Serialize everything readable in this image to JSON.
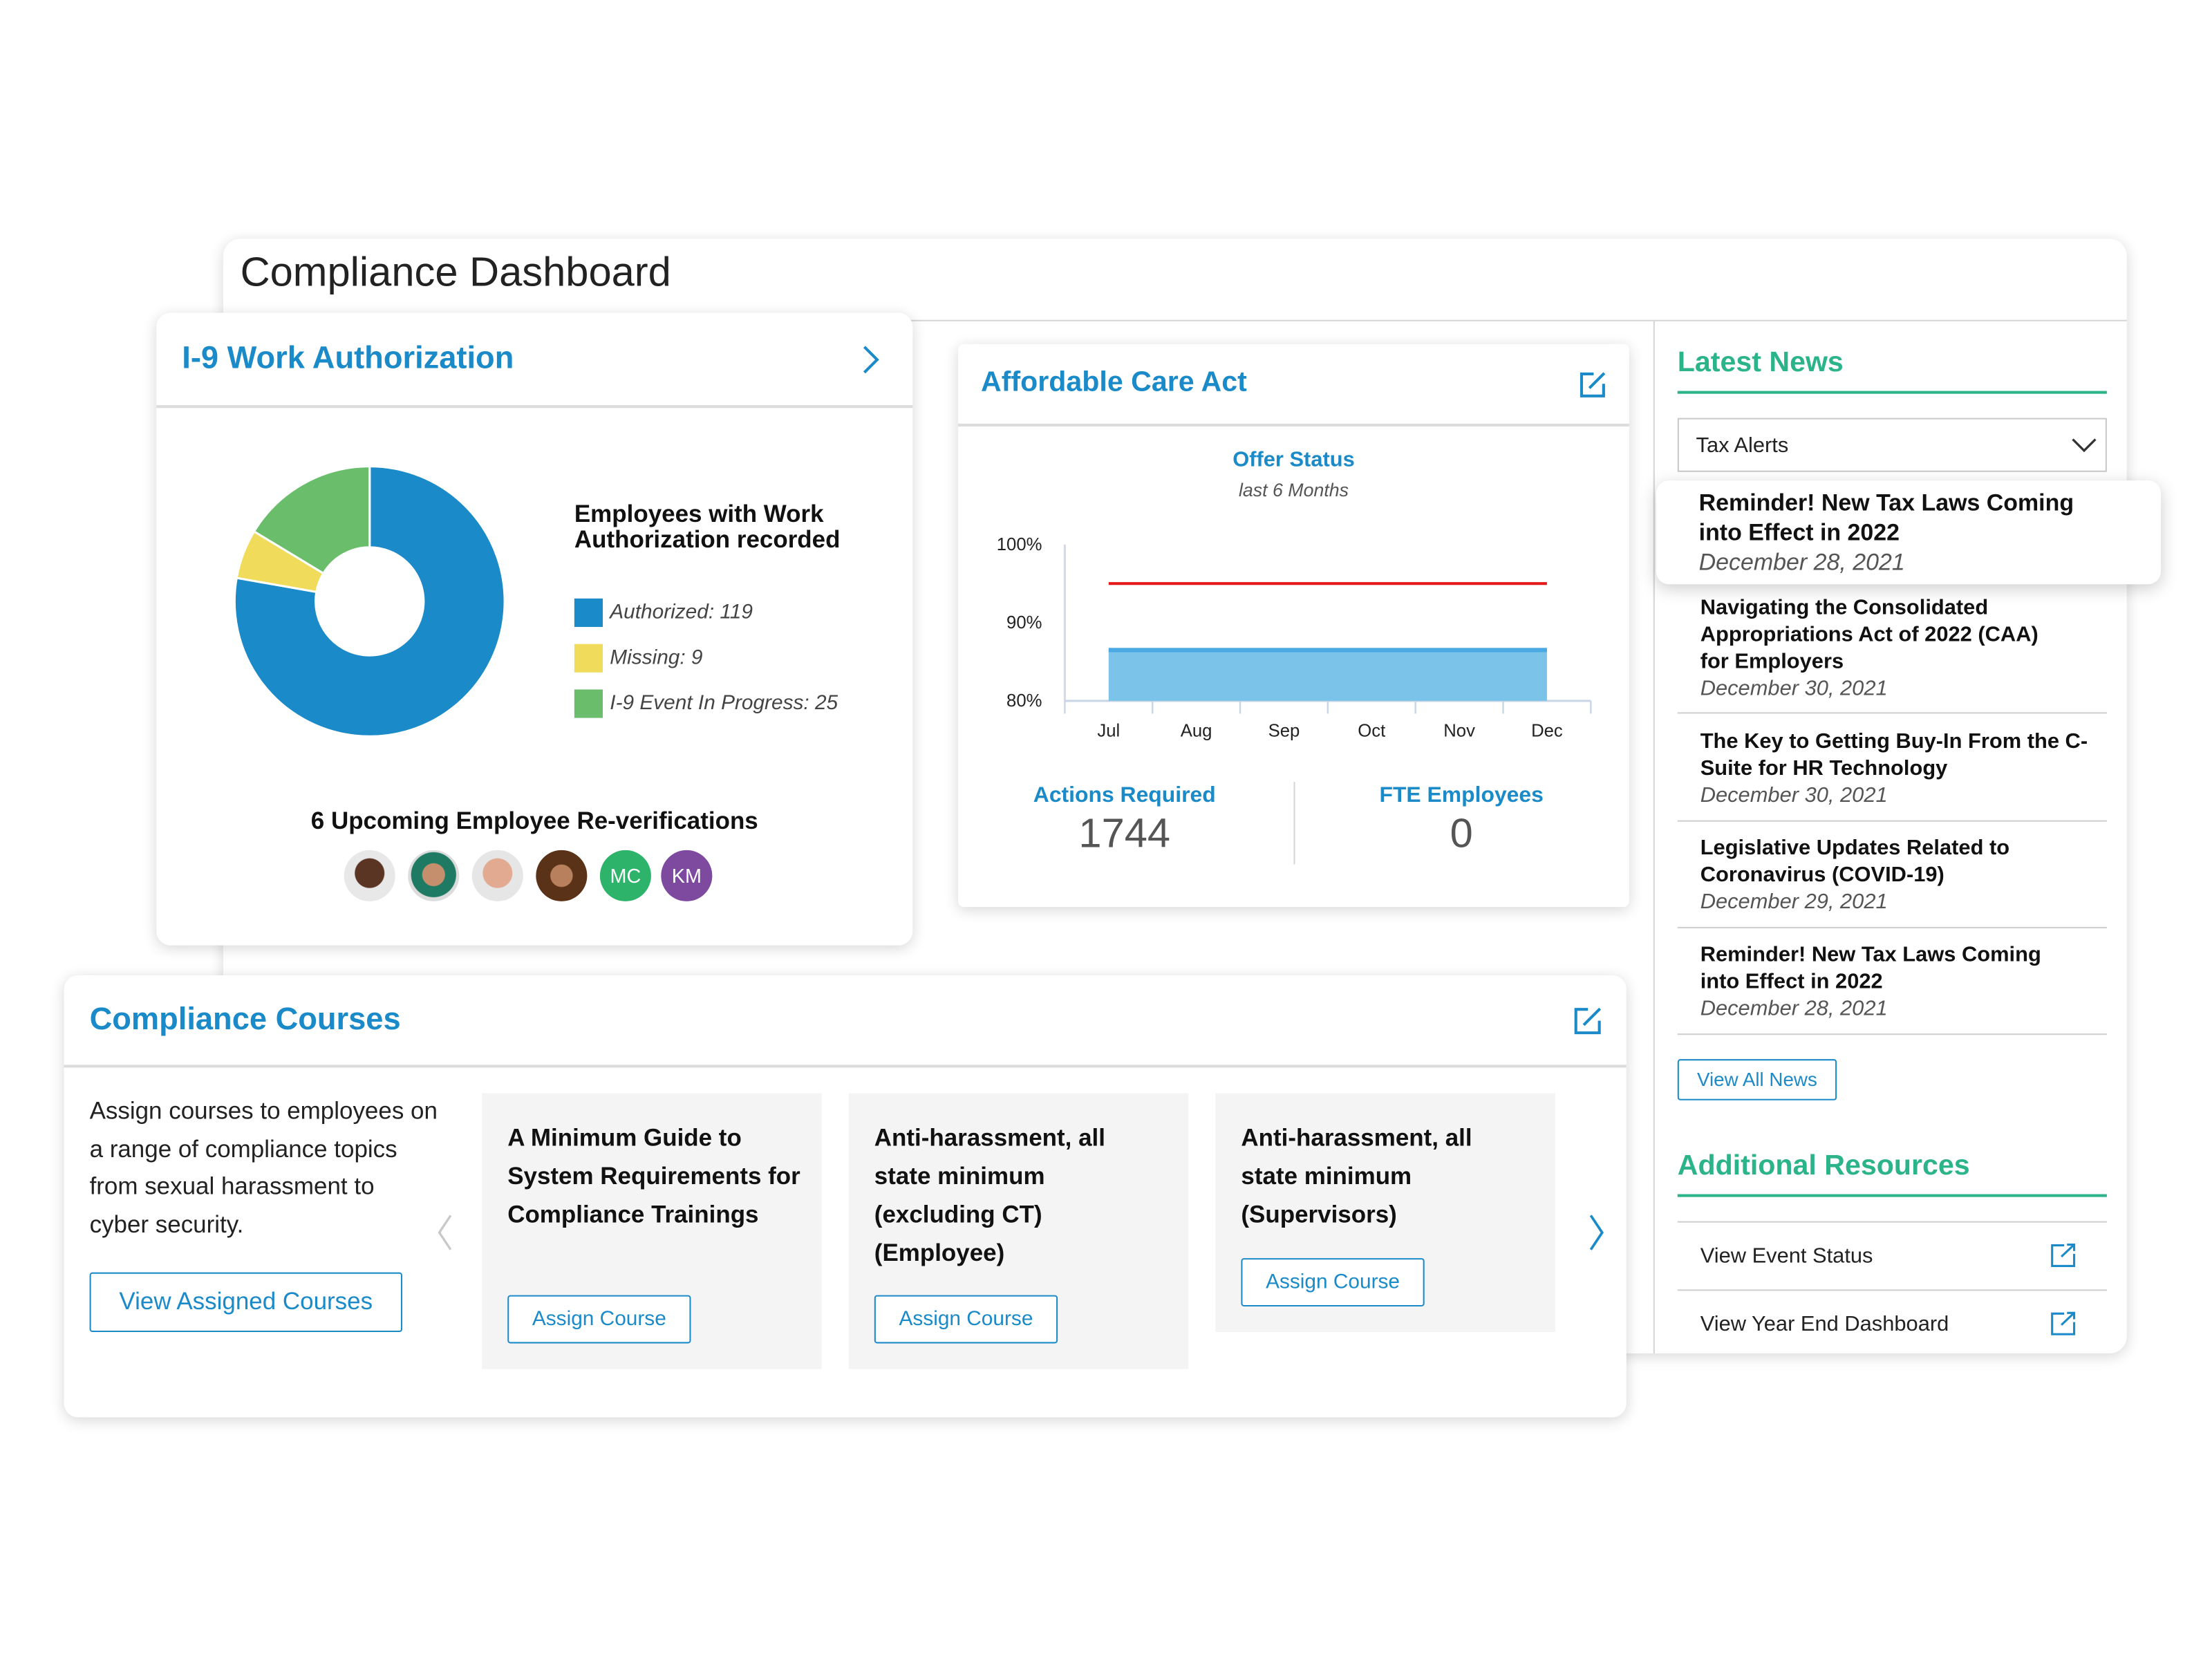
{
  "window": {
    "title": "Compliance Dashboard"
  },
  "colors": {
    "accent_blue": "#1b8ac9",
    "accent_green": "#2bb38a",
    "authorized": "#1b8ac9",
    "missing": "#f0dc5a",
    "in_progress": "#6abd6a",
    "threshold_line": "#e41a1a",
    "area_fill": "#7cc3ea"
  },
  "i9": {
    "title": "I-9 Work Authorization",
    "icon": "chevron-right-icon",
    "legend_title": "Employees with Work Authorization recorded",
    "legend": [
      {
        "label": "Authorized: 119"
      },
      {
        "label": "Missing: 9"
      },
      {
        "label": "I-9 Event In Progress: 25"
      }
    ],
    "reverifications_label": "6 Upcoming Employee Re-verifications",
    "avatars": [
      {
        "type": "photo"
      },
      {
        "type": "photo"
      },
      {
        "type": "photo"
      },
      {
        "type": "photo"
      },
      {
        "type": "initials",
        "text": "MC",
        "color": "#2db36a"
      },
      {
        "type": "initials",
        "text": "KM",
        "color": "#7d4aa0"
      }
    ]
  },
  "aca": {
    "title": "Affordable Care Act",
    "icon": "external-edit-icon",
    "chart_title": "Offer Status",
    "chart_subtitle": "last 6 Months",
    "stats": [
      {
        "label": "Actions Required",
        "value": "1744"
      },
      {
        "label": "FTE Employees",
        "value": "0"
      }
    ]
  },
  "chart_data": [
    {
      "type": "pie",
      "style": "donut",
      "categories": [
        "Authorized",
        "Missing",
        "I-9 Event In Progress"
      ],
      "values": [
        119,
        9,
        25
      ],
      "colors": [
        "#1b8ac9",
        "#f0dc5a",
        "#6abd6a"
      ],
      "legend": "right"
    },
    {
      "type": "area",
      "title": "Offer Status",
      "subtitle": "last 6 Months",
      "categories": [
        "Jul",
        "Aug",
        "Sep",
        "Oct",
        "Nov",
        "Dec"
      ],
      "y_ticks": [
        "100%",
        "90%",
        "80%"
      ],
      "ylim": [
        80,
        100
      ],
      "series": [
        {
          "values": [
            86.5,
            86.5,
            86.5,
            86.5,
            86.5,
            86.5
          ],
          "color": "#7cc3ea",
          "kind": "area"
        },
        {
          "values": [
            95,
            95,
            95,
            95,
            95,
            95
          ],
          "color": "#e41a1a",
          "kind": "line"
        }
      ],
      "grid": false
    }
  ],
  "news": {
    "title": "Latest News",
    "filter": {
      "selected": "Tax Alerts"
    },
    "items": [
      {
        "title": "Reminder! New Tax Laws Coming into Effect in 2022",
        "date": "December 28, 2021"
      },
      {
        "title": "Navigating the Consolidated Appropriations Act of 2022 (CAA) for Employers",
        "date": "December 30, 2021"
      },
      {
        "title": "The Key to Getting Buy-In From the C-Suite for HR Technology",
        "date": "December 30, 2021"
      },
      {
        "title": "Legislative Updates Related to Coronavirus (COVID-19)",
        "date": "December 29, 2021"
      },
      {
        "title": "Reminder! New Tax Laws Coming into Effect in 2022",
        "date": "December 28, 2021"
      }
    ],
    "view_all": "View All News"
  },
  "resources": {
    "title": "Additional Resources",
    "items": [
      {
        "label": "View Event Status"
      },
      {
        "label": "View Year End Dashboard"
      }
    ]
  },
  "courses": {
    "title": "Compliance Courses",
    "description": "Assign courses to employees on a range of compliance topics from sexual harassment to cyber security.",
    "view_assigned": "View Assigned Courses",
    "cards": [
      {
        "title": "A Minimum Guide to System Requirements for Compliance Trainings",
        "button": "Assign Course"
      },
      {
        "title": "Anti-harassment, all state minimum (excluding CT) (Employee)",
        "button": "Assign Course"
      },
      {
        "title": "Anti-harassment, all state minimum (Supervisors)",
        "button": "Assign Course"
      }
    ]
  }
}
